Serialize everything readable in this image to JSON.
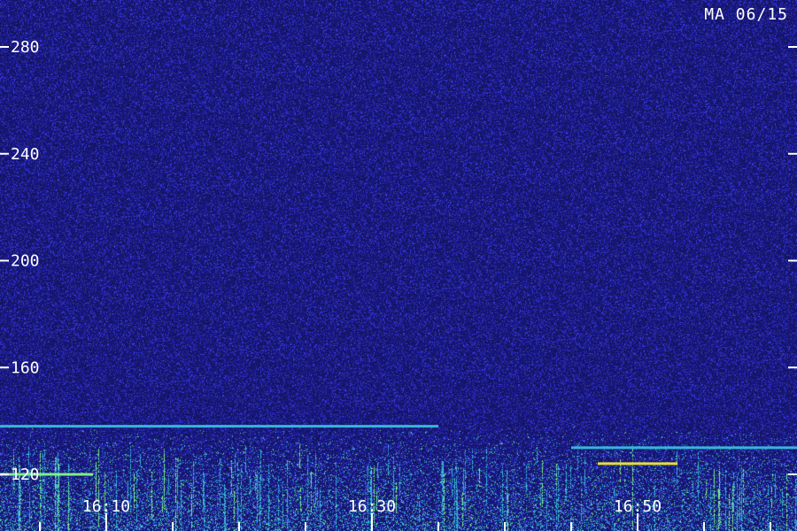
{
  "header": {
    "station": "MA 06/15"
  },
  "chart_data": {
    "type": "heatmap",
    "title": "",
    "xlabel": "",
    "ylabel": "",
    "x_ticks": [
      "16:10",
      "16:30",
      "16:50"
    ],
    "y_ticks": [
      120,
      160,
      200,
      240,
      280
    ],
    "y_range": [
      100,
      290
    ],
    "x_range": [
      "16:02",
      "17:02"
    ],
    "colors": {
      "background": "#14145c",
      "noise_low": "#1a1a8c",
      "noise_high": "#3a3ae8",
      "signal": "#36b6d8",
      "strong": "#7cf08a",
      "peak": "#e6dc3a",
      "text": "#ffffff"
    },
    "signal_lines": [
      {
        "freq": 138,
        "from": "16:02",
        "to": "16:35",
        "color": "#36b6d8"
      },
      {
        "freq": 124,
        "from": "16:47",
        "to": "16:53",
        "color": "#e6dc3a"
      },
      {
        "freq": 120,
        "from": "16:02",
        "to": "16:09",
        "color": "#7cf08a"
      },
      {
        "freq": 130,
        "from": "16:45",
        "to": "17:02",
        "color": "#36b6d8"
      }
    ]
  }
}
